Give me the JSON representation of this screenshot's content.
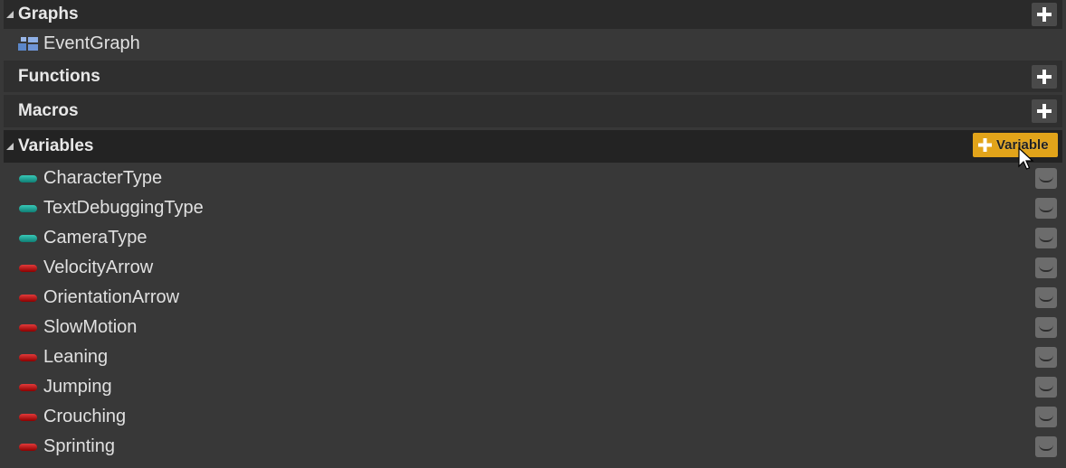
{
  "sections": {
    "graphs": {
      "title": "Graphs",
      "add_icon": "plus-icon"
    },
    "functions": {
      "title": "Functions",
      "add_icon": "plus-icon"
    },
    "macros": {
      "title": "Macros",
      "add_icon": "plus-icon"
    },
    "variables": {
      "title": "Variables",
      "add_button_label": "Variable",
      "add_icon": "plus-icon"
    }
  },
  "graphs": [
    {
      "label": "EventGraph",
      "icon": "event-graph-icon"
    }
  ],
  "variables": [
    {
      "label": "CharacterType",
      "color": "#1fa596",
      "kind": "teal"
    },
    {
      "label": "TextDebuggingType",
      "color": "#1fa596",
      "kind": "teal"
    },
    {
      "label": "CameraType",
      "color": "#1fa596",
      "kind": "teal"
    },
    {
      "label": "VelocityArrow",
      "color": "#b80d0d",
      "kind": "red"
    },
    {
      "label": "OrientationArrow",
      "color": "#b80d0d",
      "kind": "red"
    },
    {
      "label": "SlowMotion",
      "color": "#b80d0d",
      "kind": "red"
    },
    {
      "label": "Leaning",
      "color": "#b80d0d",
      "kind": "red"
    },
    {
      "label": "Jumping",
      "color": "#b80d0d",
      "kind": "red"
    },
    {
      "label": "Crouching",
      "color": "#b80d0d",
      "kind": "red"
    },
    {
      "label": "Sprinting",
      "color": "#b80d0d",
      "kind": "red"
    }
  ],
  "colors": {
    "accent": "#e2a41a",
    "panel_bg": "#383838",
    "header_bg": "#2a2a2a"
  }
}
